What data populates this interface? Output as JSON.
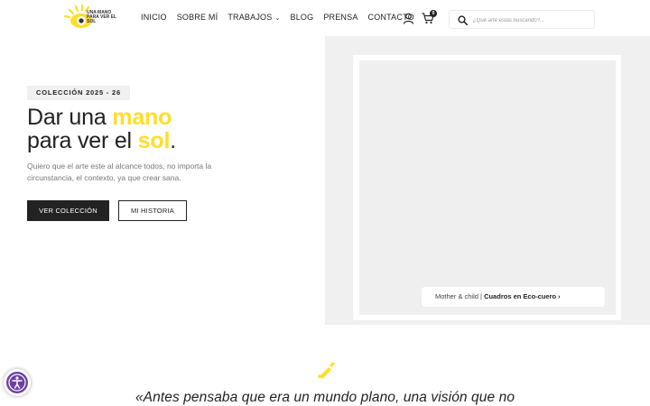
{
  "header": {
    "logo_text": "UNA MANO PARA VER EL SOL",
    "nav": [
      {
        "label": "INICIO"
      },
      {
        "label": "SOBRE MÍ"
      },
      {
        "label": "TRABAJOS",
        "has_dropdown": true
      },
      {
        "label": "BLOG"
      },
      {
        "label": "PRENSA"
      },
      {
        "label": "CONTACTO"
      }
    ],
    "cart_count": "0",
    "search": {
      "placeholder": "¿Qué arte estás buscando?..."
    }
  },
  "hero": {
    "badge": "COLECCIÓN 2025 - 26",
    "headline_part1": "Dar una ",
    "headline_hl1": "mano",
    "headline_part2": "para ver el ",
    "headline_hl2": "sol",
    "headline_end": ".",
    "subtitle": "Quiero que el arte este al alcance todos, no importa la circunstancia, el contexto, ya que crear sana.",
    "primary_button": "VER COLECCIÓN",
    "secondary_button": "MI HISTORIA"
  },
  "featured": {
    "caption_title": "Mother & child",
    "caption_sep": " | ",
    "caption_link": "Cuadros en Eco-cuero ›"
  },
  "quote": {
    "text": "«Antes pensaba que era un mundo plano, una visión que no"
  },
  "colors": {
    "accent": "#ffde2b",
    "dark": "#222222",
    "panel": "#f0f0f0",
    "accessibility": "#6e3fa3"
  },
  "icons": [
    "logo-sun-eye-icon",
    "user-icon",
    "cart-icon",
    "search-icon",
    "paintbrush-icon",
    "accessibility-icon"
  ]
}
